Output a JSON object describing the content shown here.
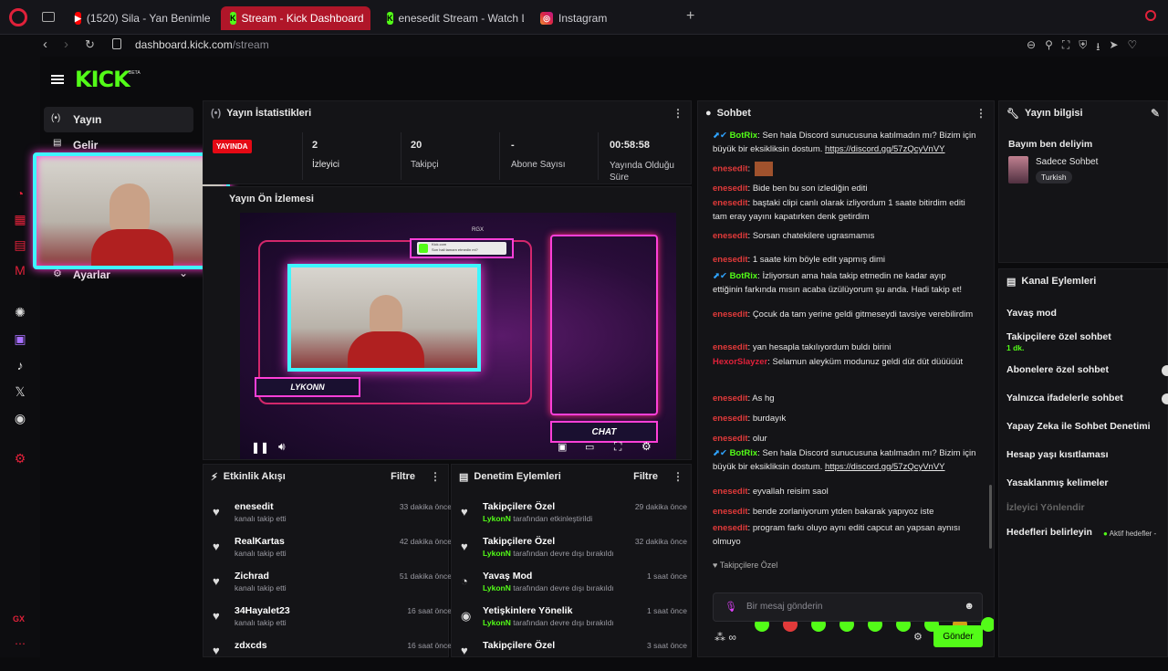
{
  "browser": {
    "tabs": [
      {
        "label": "(1520) Sila - Yan Benimle",
        "icon": "youtube-icon"
      },
      {
        "label": "Stream - Kick Dashboard",
        "icon": "kick-icon"
      },
      {
        "label": "enesedit Stream - Watch L",
        "icon": "kick-icon"
      },
      {
        "label": "Instagram",
        "icon": "instagram-icon"
      }
    ],
    "url_domain": "dashboard.kick.com",
    "url_path": "/stream"
  },
  "opera_sidebar": {
    "bottom_label": "GX"
  },
  "kick": {
    "logo": "KICK",
    "beta": "BETA",
    "nav": {
      "yayin": "Yayın",
      "gelir": "Gelir",
      "ayarlar": "Ayarlar"
    }
  },
  "stats": {
    "title": "Yayın İstatistikleri",
    "live_badge": "YAYINDA",
    "items": [
      {
        "value": "2",
        "label": "İzleyici"
      },
      {
        "value": "20",
        "label": "Takipçi"
      },
      {
        "value": "-",
        "label": "Abone Sayısı"
      },
      {
        "value": "00:58:58",
        "label": "Yayında Olduğu Süre"
      }
    ]
  },
  "preview": {
    "title": "Yayın Ön İzlemesi",
    "overlay_name": "LYKONN",
    "overlay_chat": "CHAT",
    "overlay_rgx": "RGX",
    "notif_title": "Kick.com",
    "notif_text": "Son hali tamam etmedin mi?"
  },
  "activity": {
    "title": "Etkinlik Akışı",
    "filter": "Filtre",
    "items": [
      {
        "name": "enesedit",
        "sub": "kanalı takip etti",
        "time": "33 dakika önce"
      },
      {
        "name": "RealKartas",
        "sub": "kanalı takip etti",
        "time": "42 dakika önce"
      },
      {
        "name": "Zichrad",
        "sub": "kanalı takip etti",
        "time": "51 dakika önce"
      },
      {
        "name": "34Hayalet23",
        "sub": "kanalı takip etti",
        "time": "16 saat önce"
      },
      {
        "name": "zdxcds",
        "sub": "",
        "time": "16 saat önce"
      }
    ]
  },
  "moderation": {
    "title": "Denetim Eylemleri",
    "filter": "Filtre",
    "items": [
      {
        "name": "Takipçilere Özel",
        "actor": "LykonN",
        "sub": " tarafından etkinleştirildi",
        "time": "29 dakika önce"
      },
      {
        "name": "Takipçilere Özel",
        "actor": "LykonN",
        "sub": " tarafından devre dışı bırakıldı",
        "time": "32 dakika önce"
      },
      {
        "name": "Yavaş Mod",
        "actor": "LykonN",
        "sub": " tarafından devre dışı bırakıldı",
        "time": "1 saat önce"
      },
      {
        "name": "Yetişkinlere Yönelik",
        "actor": "LykonN",
        "sub": " tarafından devre dışı bırakıldı",
        "time": "1 saat önce"
      },
      {
        "name": "Takipçilere Özel",
        "actor": "",
        "sub": "",
        "time": "3 saat önce"
      }
    ]
  },
  "chat": {
    "title": "Sohbet",
    "messages": [
      {
        "user": "BotRix",
        "bot": true,
        "text": ": Sen hala Discord sunucusuna katılmadın mı? Bizim için büyük bir eksikliksin dostum. ",
        "link": "https://discord.gg/57zQcyVnVY"
      },
      {
        "user": "enesedit",
        "bot": false,
        "text": ": ",
        "link": ""
      },
      {
        "user": "enesedit",
        "bot": false,
        "text": ": Bide ben bu son izlediğin editi",
        "link": ""
      },
      {
        "user": "enesedit",
        "bot": false,
        "text": ": baştaki clipi canlı olarak izliyordum 1 saate bitirdim editi tam eray yayını kapatırken denk getirdim",
        "link": ""
      },
      {
        "user": "enesedit",
        "bot": false,
        "text": ": Sorsan chatekilere ugrasmamıs",
        "link": ""
      },
      {
        "user": "enesedit",
        "bot": false,
        "text": ": 1 saate kim böyle edit yapmış dimi",
        "link": ""
      },
      {
        "user": "BotRix",
        "bot": true,
        "text": ": İzliyorsun ama hala takip etmedin ne kadar ayıp ettiğinin farkında mısın acaba üzülüyorum şu anda. Hadi takip et!",
        "link": ""
      },
      {
        "user": "enesedit",
        "bot": false,
        "text": ": Çocuk da tam yerine geldi gitmeseydi tavsiye verebilirdim",
        "link": ""
      },
      {
        "user": "enesedit",
        "bot": false,
        "text": ": yan hesapla takılıyordum buldı birini",
        "link": ""
      },
      {
        "user": "HexorSlayzer",
        "bot": false,
        "text": ": Selamun aleyküm modunuz geldi düt düt düüüüüt",
        "link": ""
      },
      {
        "user": "enesedit",
        "bot": false,
        "text": ": As hg",
        "link": ""
      },
      {
        "user": "enesedit",
        "bot": false,
        "text": ": burdayık",
        "link": ""
      },
      {
        "user": "enesedit",
        "bot": false,
        "text": ": olur",
        "link": ""
      },
      {
        "user": "BotRix",
        "bot": true,
        "text": ": Sen hala Discord sunucusuna katılmadın mı? Bizim için büyük bir eksikliksin dostum. ",
        "link": "https://discord.gg/57zQcyVnVY"
      },
      {
        "user": "enesedit",
        "bot": false,
        "text": ": eyvallah reisim saol",
        "link": ""
      },
      {
        "user": "enesedit",
        "bot": false,
        "text": ": bende zorlaniyorum ytden bakarak yapıyoz iste",
        "link": ""
      },
      {
        "user": "enesedit",
        "bot": false,
        "text": ": program farkı oluyo aynı editi capcut an yapsan aynısı olmuyo",
        "link": ""
      }
    ],
    "mode_label": "Takipçilere Özel",
    "input_placeholder": "Bir mesaj gönderin",
    "send": "Gönder"
  },
  "stream_info": {
    "title": "Yayın bilgisi",
    "stream_title": "Bayım ben deliyim",
    "category": "Sadece Sohbet",
    "language": "Turkish"
  },
  "channel_actions": {
    "title": "Kanal Eylemleri",
    "items": [
      {
        "label": "Yavaş mod",
        "sub": "",
        "toggle": false,
        "dim": false
      },
      {
        "label": "Takipçilere özel sohbet",
        "sub": "1 dk.",
        "toggle": false,
        "dim": false
      },
      {
        "label": "Abonelere özel sohbet",
        "sub": "",
        "toggle": true,
        "dim": false
      },
      {
        "label": "Yalnızca ifadelerle sohbet",
        "sub": "",
        "toggle": true,
        "dim": false
      },
      {
        "label": "Yapay Zeka ile Sohbet Denetimi",
        "sub": "",
        "toggle": false,
        "dim": false
      },
      {
        "label": "Hesap yaşı kısıtlaması",
        "sub": "",
        "toggle": false,
        "dim": false
      },
      {
        "label": "Yasaklanmış kelimeler",
        "sub": "",
        "toggle": false,
        "dim": false
      },
      {
        "label": "İzleyici Yönlendir",
        "sub": "",
        "toggle": false,
        "dim": true
      },
      {
        "label": "Hedefleri belirleyin",
        "sub": "",
        "toggle": false,
        "dim": false
      }
    ],
    "goals_status": "Aktif hedefler -"
  },
  "colors": {
    "accent": "#53fc18",
    "live": "#e50914",
    "chat_user": "#e23a3a",
    "tab_active": "#b01629"
  }
}
